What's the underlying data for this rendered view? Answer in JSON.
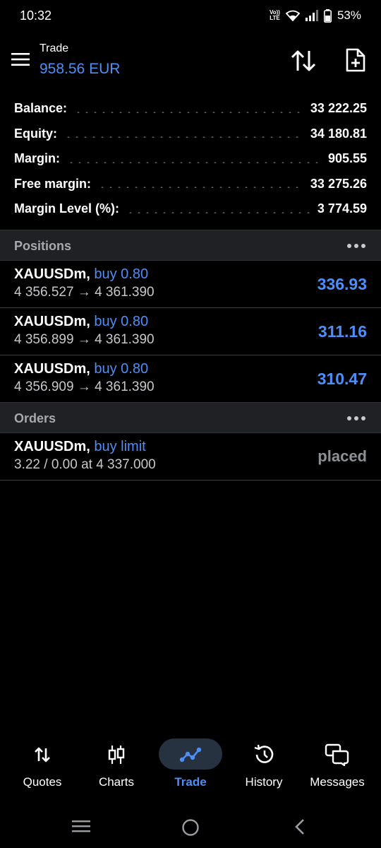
{
  "status_bar": {
    "time": "10:32",
    "volte_line1": "Vo))",
    "volte_line2": "LTE",
    "battery": "53%"
  },
  "header": {
    "title": "Trade",
    "balance": "958.56 EUR"
  },
  "summary": [
    {
      "label": "Balance:",
      "value": "33 222.25"
    },
    {
      "label": "Equity:",
      "value": "34 180.81"
    },
    {
      "label": "Margin:",
      "value": "905.55"
    },
    {
      "label": "Free margin:",
      "value": "33 275.26"
    },
    {
      "label": "Margin Level (%):",
      "value": "3 774.59"
    }
  ],
  "positions": {
    "title": "Positions",
    "items": [
      {
        "symbol": "XAUUSDm,",
        "type": " buy 0.80",
        "prices": "4 356.527 → 4 361.390",
        "profit": "336.93"
      },
      {
        "symbol": "XAUUSDm,",
        "type": " buy 0.80",
        "prices": "4 356.899 → 4 361.390",
        "profit": "311.16"
      },
      {
        "symbol": "XAUUSDm,",
        "type": " buy 0.80",
        "prices": "4 356.909 → 4 361.390",
        "profit": "310.47"
      }
    ]
  },
  "orders": {
    "title": "Orders",
    "items": [
      {
        "symbol": "XAUUSDm,",
        "type": " buy limit",
        "details": "3.22 / 0.00 at 4 337.000",
        "status": "placed"
      }
    ]
  },
  "bottom_nav": [
    {
      "label": "Quotes",
      "icon": "quotes-icon",
      "active": false
    },
    {
      "label": "Charts",
      "icon": "charts-icon",
      "active": false
    },
    {
      "label": "Trade",
      "icon": "trade-icon",
      "active": true
    },
    {
      "label": "History",
      "icon": "history-icon",
      "active": false
    },
    {
      "label": "Messages",
      "icon": "messages-icon",
      "active": false
    }
  ],
  "colors": {
    "accent": "#4d8ef7",
    "background": "#000000",
    "section_bg": "#1f2124",
    "muted_text": "#a6a9ad"
  }
}
